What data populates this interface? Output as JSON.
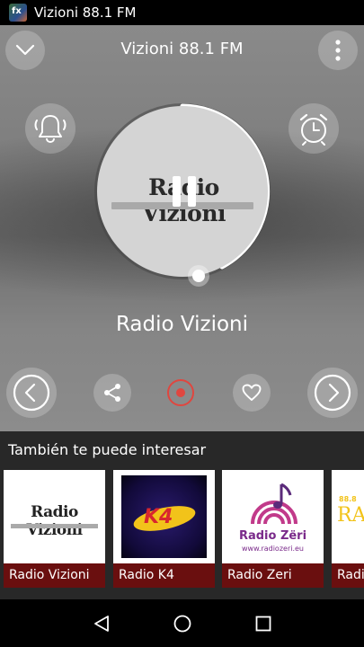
{
  "status_bar": {
    "app_title": "Vizioni 88.1 FM",
    "app_icon": "app-logo-icon"
  },
  "header": {
    "title": "Vizioni 88.1 FM"
  },
  "player": {
    "artwork_text": "Radio Vizioni",
    "station_name": "Radio Vizioni"
  },
  "recommendations": {
    "heading": "También te puede interesar",
    "items": [
      {
        "label": "Radio Vizioni",
        "logo_text": "Radio Vizioni"
      },
      {
        "label": "Radio K4",
        "logo_text": "K4"
      },
      {
        "label": "Radio Zeri",
        "logo_text": "Radio Zëri",
        "logo_sub": "www.radiozeri.eu"
      },
      {
        "label": "Radio",
        "logo_text": "RA"
      }
    ]
  },
  "colors": {
    "accent": "#e0463f",
    "card_label_bg": "#6a0f0f",
    "panel_bg": "#282828"
  }
}
